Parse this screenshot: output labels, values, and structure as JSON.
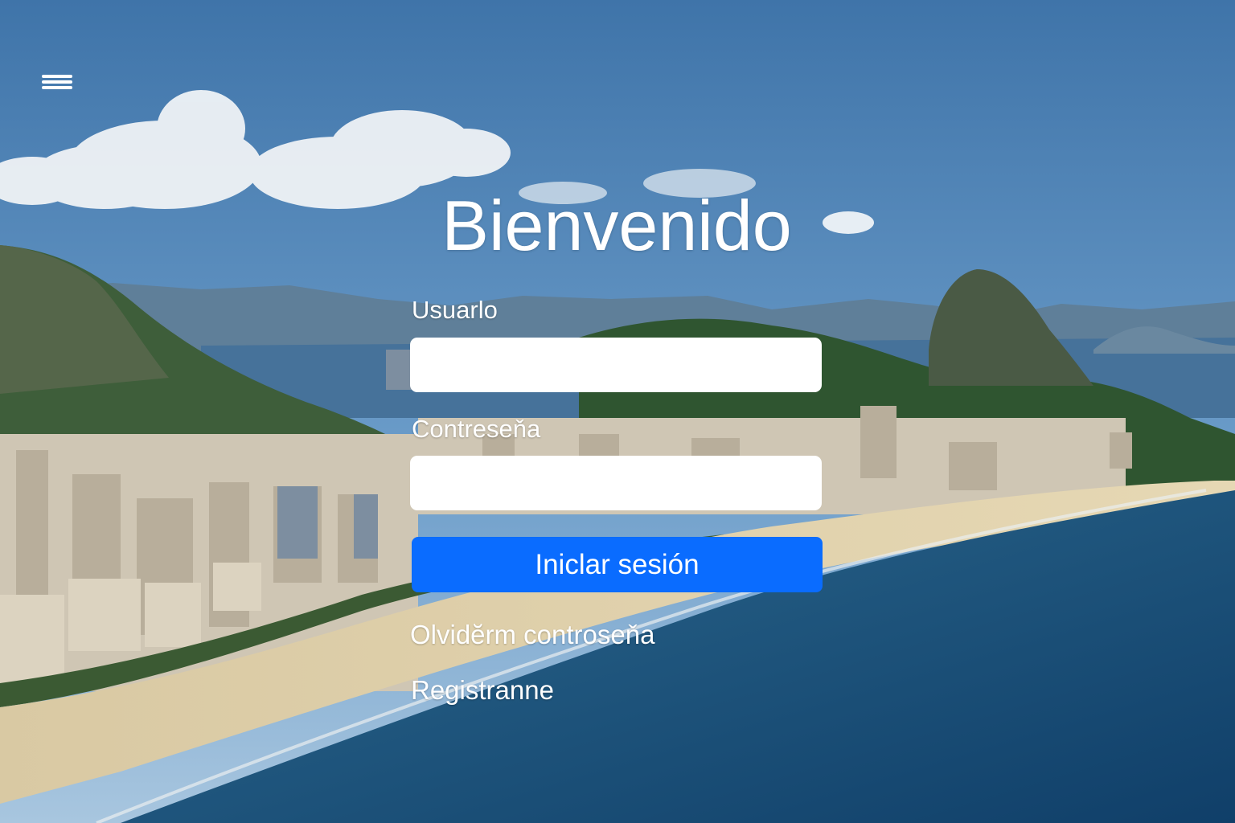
{
  "colors": {
    "primary_button": "#0a6cff",
    "text": "#ffffff",
    "input_background": "#ffffff"
  },
  "header": {
    "menu_icon": "hamburger-icon"
  },
  "login": {
    "title": "Bienvenido",
    "username_label": "Usuarlo",
    "username_value": "",
    "password_label": "Contreseňa",
    "password_value": "",
    "submit_label": "Iniclar sesión",
    "forgot_link": "Olvidĕrm controseňa",
    "register_link": "Registranne"
  },
  "background": {
    "scene": "coastal-city-landscape"
  }
}
